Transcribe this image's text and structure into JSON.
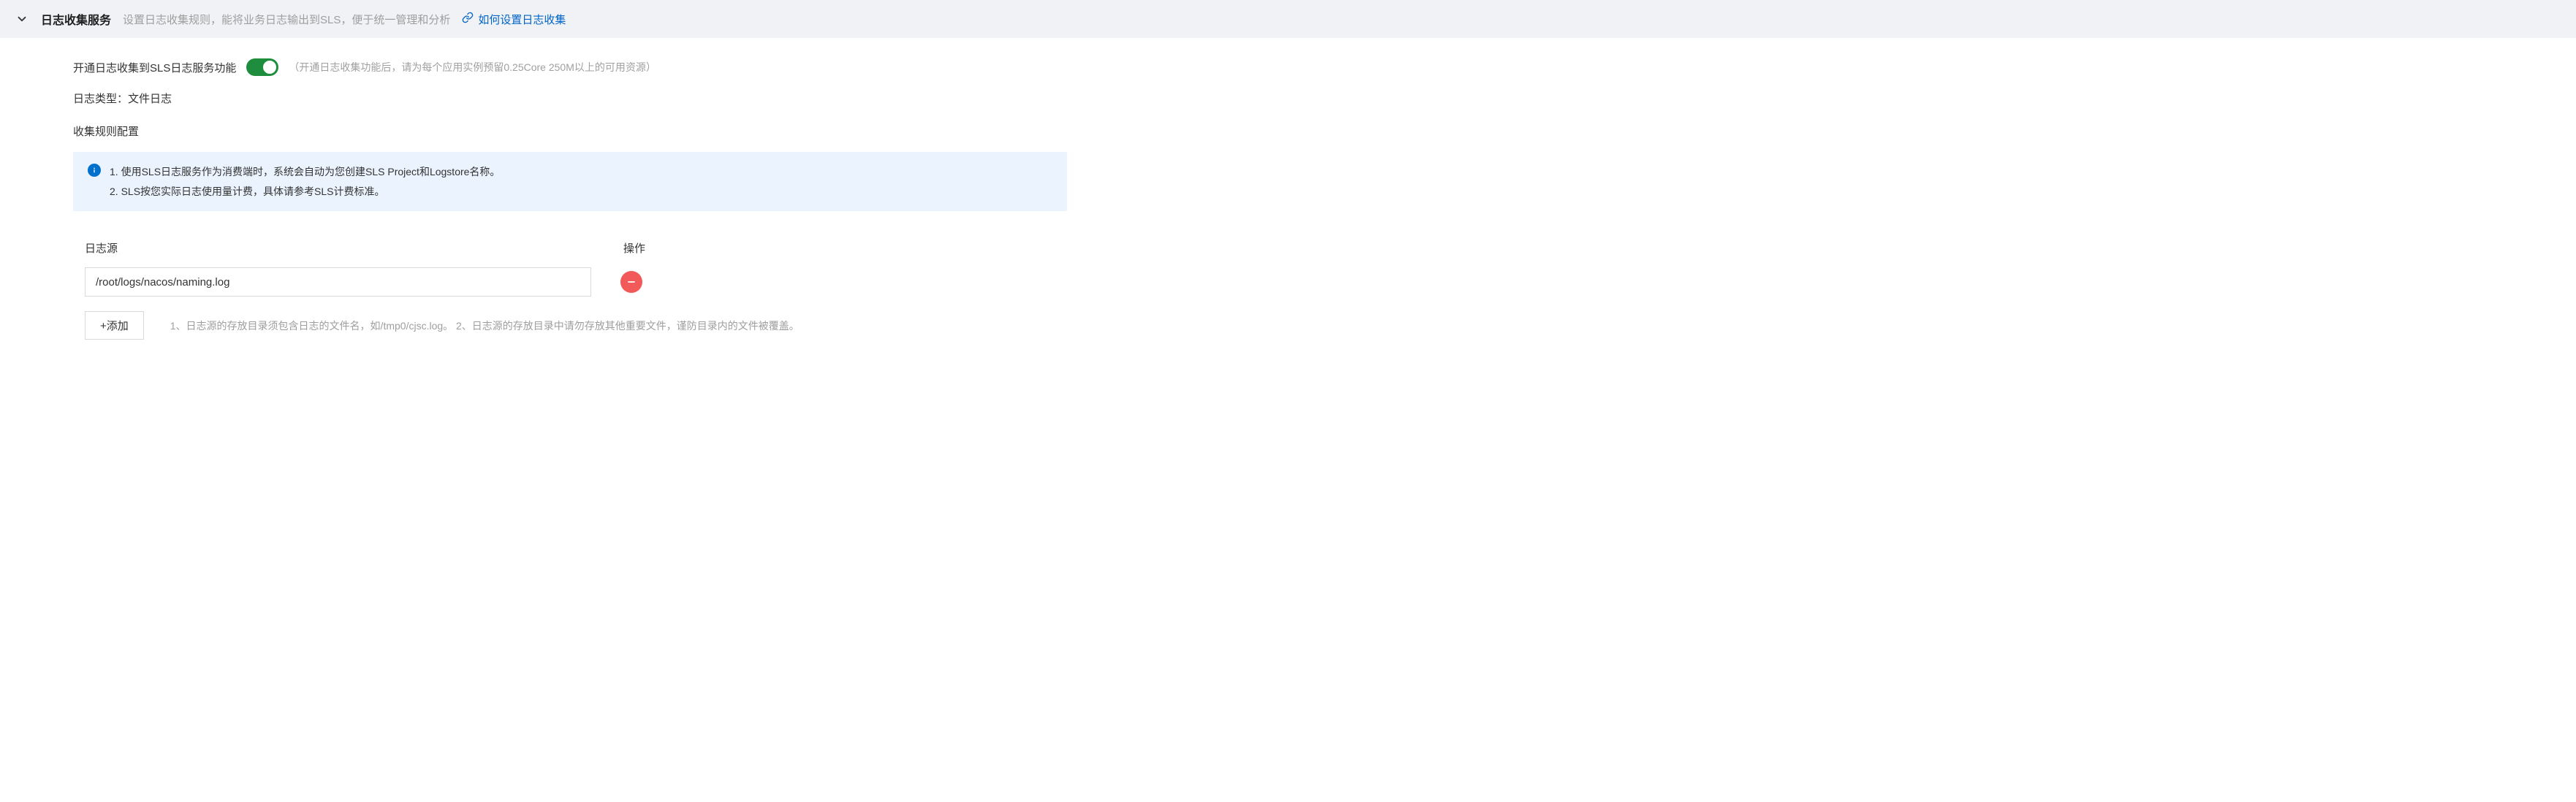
{
  "header": {
    "title": "日志收集服务",
    "description": "设置日志收集规则，能将业务日志输出到SLS，便于统一管理和分析",
    "link_label": "如何设置日志收集"
  },
  "enable": {
    "label": "开通日志收集到SLS日志服务功能",
    "hint": "（开通日志收集功能后，请为每个应用实例预留0.25Core 250M以上的可用资源）",
    "on": true
  },
  "log_type": {
    "label": "日志类型：",
    "value": "文件日志"
  },
  "rule_section_title": "收集规则配置",
  "info": {
    "line1": "1. 使用SLS日志服务作为消费端时，系统会自动为您创建SLS Project和Logstore名称。",
    "line2": "2. SLS按您实际日志使用量计费，具体请参考SLS计费标准。"
  },
  "table": {
    "col_source": "日志源",
    "col_action": "操作",
    "rows": [
      {
        "path": "/root/logs/nacos/naming.log"
      }
    ]
  },
  "add_button": "+添加",
  "footer_tip": "1、日志源的存放目录须包含日志的文件名，如/tmp0/cjsc.log。 2、日志源的存放目录中请勿存放其他重要文件，谨防目录内的文件被覆盖。"
}
